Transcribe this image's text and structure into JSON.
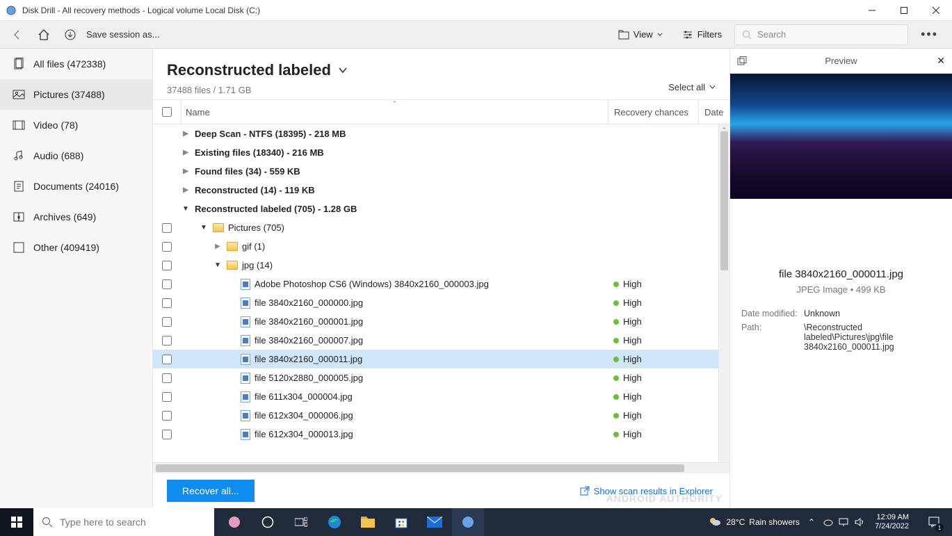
{
  "titlebar": {
    "title": "Disk Drill - All recovery methods - Logical volume Local Disk (C:)"
  },
  "toolbar": {
    "save_session": "Save session as...",
    "view": "View",
    "filters": "Filters",
    "search_placeholder": "Search"
  },
  "sidebar": {
    "items": [
      {
        "label": "All files (472338)"
      },
      {
        "label": "Pictures (37488)"
      },
      {
        "label": "Video (78)"
      },
      {
        "label": "Audio (688)"
      },
      {
        "label": "Documents (24016)"
      },
      {
        "label": "Archives (649)"
      },
      {
        "label": "Other (409419)"
      }
    ]
  },
  "header": {
    "title": "Reconstructed labeled",
    "summary": "37488 files / 1.71 GB",
    "select_all": "Select all"
  },
  "columns": {
    "name": "Name",
    "recovery": "Recovery chances",
    "date": "Date"
  },
  "groups": [
    {
      "label": "Deep Scan - NTFS (18395) - 218 MB"
    },
    {
      "label": "Existing files (18340) - 216 MB"
    },
    {
      "label": "Found files (34) - 559 KB"
    },
    {
      "label": "Reconstructed (14) - 119 KB"
    },
    {
      "label": "Reconstructed labeled (705) - 1.28 GB"
    }
  ],
  "folders": {
    "pictures": "Pictures (705)",
    "gif": "gif (1)",
    "jpg": "jpg (14)"
  },
  "files": [
    {
      "name": "Adobe Photoshop CS6 (Windows) 3840x2160_000003.jpg",
      "recovery": "High"
    },
    {
      "name": "file 3840x2160_000000.jpg",
      "recovery": "High"
    },
    {
      "name": "file 3840x2160_000001.jpg",
      "recovery": "High"
    },
    {
      "name": "file 3840x2160_000007.jpg",
      "recovery": "High"
    },
    {
      "name": "file 3840x2160_000011.jpg",
      "recovery": "High"
    },
    {
      "name": "file 5120x2880_000005.jpg",
      "recovery": "High"
    },
    {
      "name": "file 611x304_000004.jpg",
      "recovery": "High"
    },
    {
      "name": "file 612x304_000006.jpg",
      "recovery": "High"
    },
    {
      "name": "file 612x304_000013.jpg",
      "recovery": "High"
    }
  ],
  "recover": {
    "button": "Recover all...",
    "explorer": "Show scan results in Explorer"
  },
  "preview": {
    "title": "Preview",
    "filename": "file 3840x2160_000011.jpg",
    "meta": "JPEG Image • 499 KB",
    "date_modified_label": "Date modified:",
    "date_modified": "Unknown",
    "path_label": "Path:",
    "path": "\\Reconstructed labeled\\Pictures\\jpg\\file 3840x2160_000011.jpg",
    "watermark": "ANDROID AUTHORITY"
  },
  "taskbar": {
    "search_placeholder": "Type here to search",
    "temp": "28°C",
    "weather": "Rain showers",
    "time": "12:09 AM",
    "date": "7/24/2022",
    "notif_count": "1"
  }
}
